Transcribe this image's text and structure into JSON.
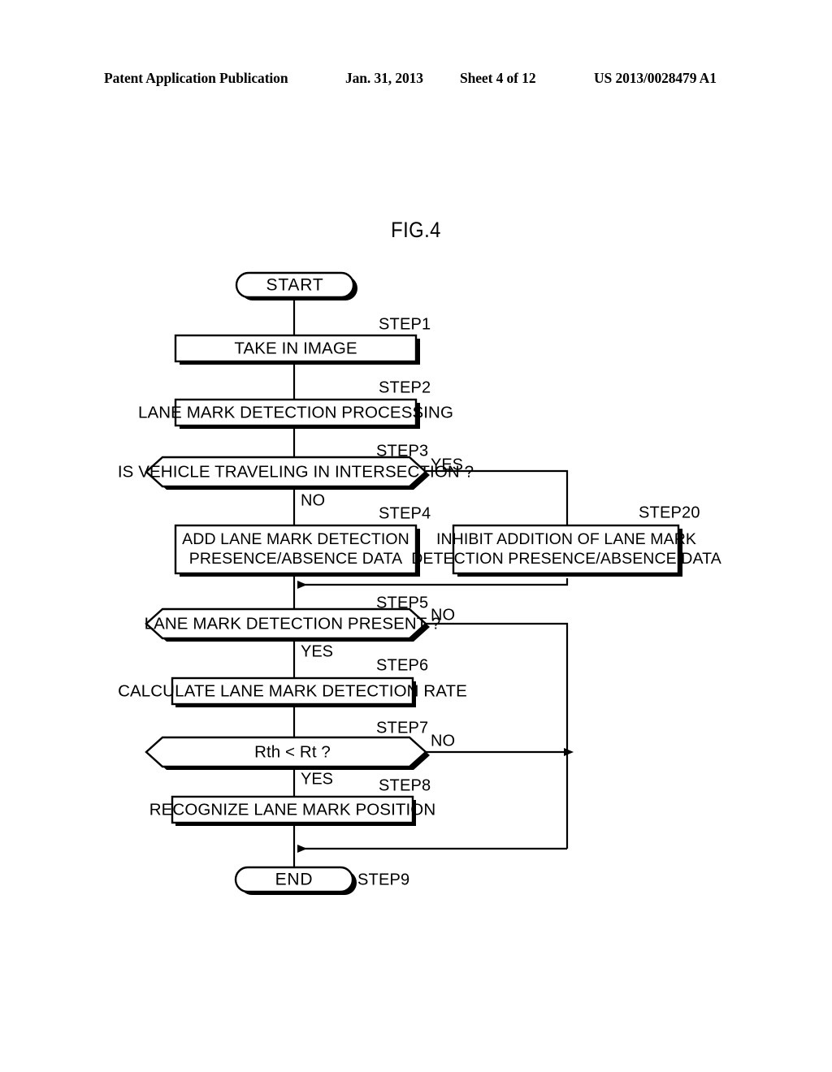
{
  "header": {
    "publication": "Patent Application Publication",
    "date": "Jan. 31, 2013",
    "sheet": "Sheet 4 of 12",
    "document_number": "US 2013/0028479 A1"
  },
  "figure": {
    "title": "FIG.4"
  },
  "chart_data": {
    "type": "diagram",
    "diagram_type": "flowchart",
    "title": "FIG.4",
    "nodes": [
      {
        "id": "start",
        "step": "",
        "shape": "terminator",
        "text": "START"
      },
      {
        "id": "step1",
        "step": "STEP1",
        "shape": "process",
        "text": "TAKE IN IMAGE"
      },
      {
        "id": "step2",
        "step": "STEP2",
        "shape": "process",
        "text": "LANE MARK DETECTION PROCESSING"
      },
      {
        "id": "step3",
        "step": "STEP3",
        "shape": "decision",
        "text": "IS VEHICLE TRAVELING IN INTERSECTION ?"
      },
      {
        "id": "step4",
        "step": "STEP4",
        "shape": "process",
        "text_line1": "ADD LANE MARK DETECTION",
        "text_line2": "PRESENCE/ABSENCE DATA"
      },
      {
        "id": "step20",
        "step": "STEP20",
        "shape": "process",
        "text_line1": "INHIBIT ADDITION OF LANE MARK",
        "text_line2": "DETECTION PRESENCE/ABSENCE DATA"
      },
      {
        "id": "step5",
        "step": "STEP5",
        "shape": "decision",
        "text": "LANE MARK DETECTION PRESENT ?"
      },
      {
        "id": "step6",
        "step": "STEP6",
        "shape": "process",
        "text": "CALCULATE LANE MARK DETECTION RATE"
      },
      {
        "id": "step7",
        "step": "STEP7",
        "shape": "decision",
        "text": "Rth < Rt ?"
      },
      {
        "id": "step8",
        "step": "STEP8",
        "shape": "process",
        "text": "RECOGNIZE LANE MARK POSITION"
      },
      {
        "id": "end",
        "step": "STEP9",
        "shape": "terminator",
        "text": "END"
      }
    ],
    "edges": [
      {
        "from": "start",
        "to": "step1",
        "label": ""
      },
      {
        "from": "step1",
        "to": "step2",
        "label": ""
      },
      {
        "from": "step2",
        "to": "step3",
        "label": ""
      },
      {
        "from": "step3",
        "to": "step4",
        "label": "NO"
      },
      {
        "from": "step3",
        "to": "step20",
        "label": "YES"
      },
      {
        "from": "step4",
        "to": "step5",
        "label": ""
      },
      {
        "from": "step20",
        "to": "step5",
        "label": ""
      },
      {
        "from": "step5",
        "to": "step6",
        "label": "YES"
      },
      {
        "from": "step5",
        "to": "end",
        "label": "NO"
      },
      {
        "from": "step6",
        "to": "step7",
        "label": ""
      },
      {
        "from": "step7",
        "to": "step8",
        "label": "YES"
      },
      {
        "from": "step7",
        "to": "end",
        "label": "NO"
      },
      {
        "from": "step8",
        "to": "end",
        "label": ""
      }
    ],
    "branch_labels": {
      "step3_yes": "YES",
      "step3_no": "NO",
      "step5_no": "NO",
      "step5_yes": "YES",
      "step7_no": "NO",
      "step7_yes": "YES"
    },
    "colors": {
      "stroke": "#000000",
      "fill": "#ffffff",
      "text": "#000000"
    }
  }
}
